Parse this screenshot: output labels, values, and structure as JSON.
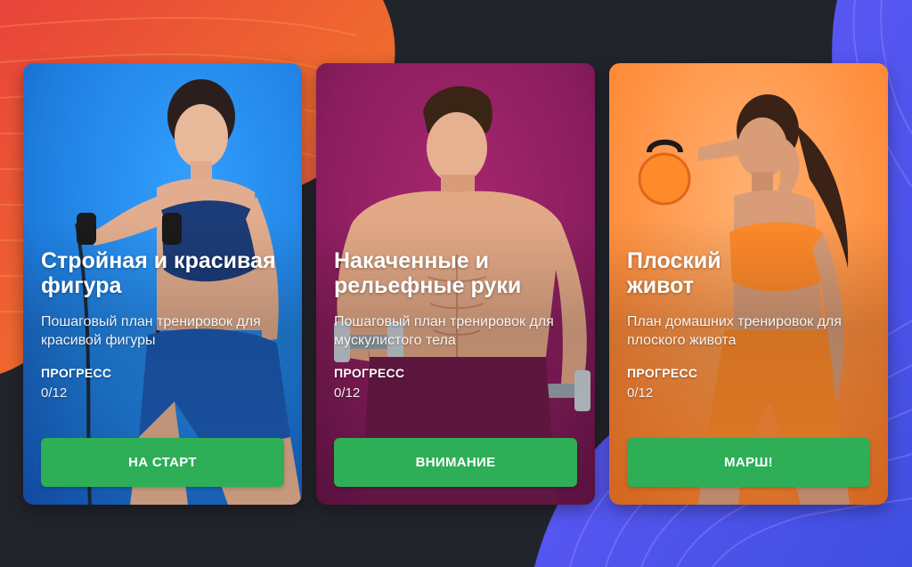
{
  "colors": {
    "page_background": "#22242b",
    "button": "#2dae57",
    "card_1": "#1f7fe0",
    "card_2": "#8a1d5e",
    "card_3": "#ff8c3a"
  },
  "cards": [
    {
      "title": "Стройная и красивая фигура",
      "subtitle": "Пошаговый план тренировок для красивой фигуры",
      "progress_label": "ПРОГРЕСС",
      "progress_value": "0/12",
      "button_label": "НА СТАРТ",
      "illustration": "woman-with-resistance-band"
    },
    {
      "title": "Накаченные и рельефные руки",
      "subtitle": "Пошаговый план тренировок для мускулистого тела",
      "progress_label": "ПРОГРЕСС",
      "progress_value": "0/12",
      "button_label": "ВНИМАНИЕ",
      "illustration": "man-with-dumbbells"
    },
    {
      "title": "Плоский живот",
      "subtitle": "План домашних тренировок для плоского живота",
      "progress_label": "ПРОГРЕСС",
      "progress_value": "0/12",
      "button_label": "МАРШ!",
      "illustration": "woman-with-kettlebell"
    }
  ]
}
